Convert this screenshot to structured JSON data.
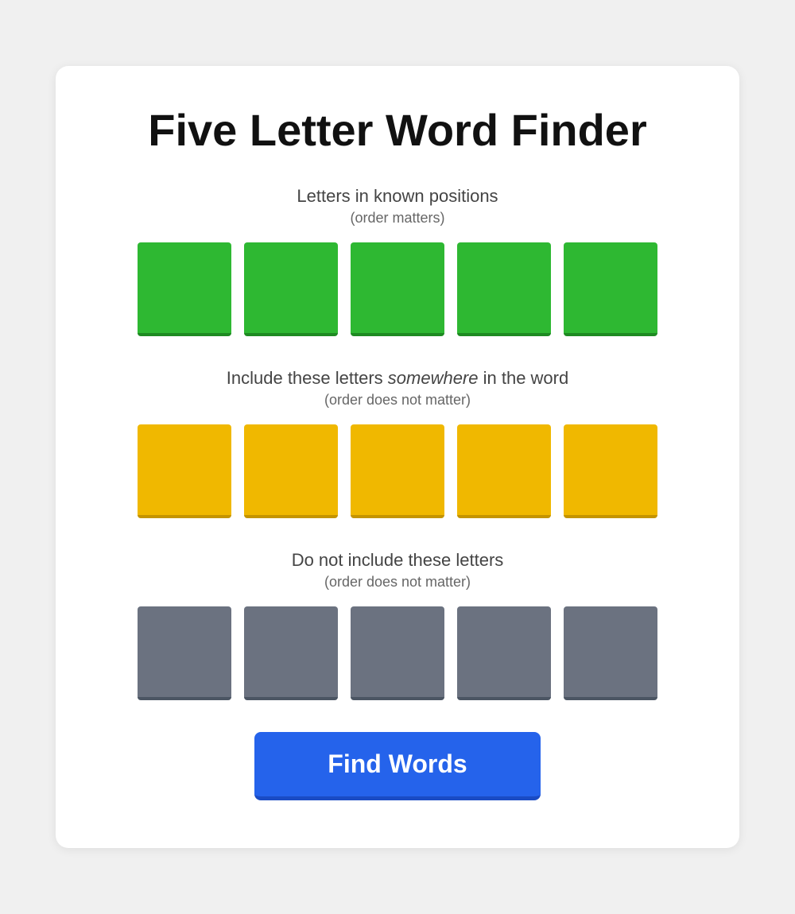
{
  "page": {
    "title": "Five Letter Word Finder"
  },
  "sections": {
    "known": {
      "label": "Letters in known positions",
      "sublabel": "(order matters)",
      "tiles": [
        "",
        "",
        "",
        "",
        ""
      ],
      "color": "green"
    },
    "include": {
      "label_pre": "Include these letters ",
      "label_em": "somewhere",
      "label_post": " in the word",
      "sublabel": "(order does not matter)",
      "tiles": [
        "",
        "",
        "",
        "",
        ""
      ],
      "color": "yellow"
    },
    "exclude": {
      "label": "Do not include these letters",
      "sublabel": "(order does not matter)",
      "tiles": [
        "",
        "",
        "",
        "",
        ""
      ],
      "color": "gray"
    }
  },
  "button": {
    "label": "Find Words"
  }
}
